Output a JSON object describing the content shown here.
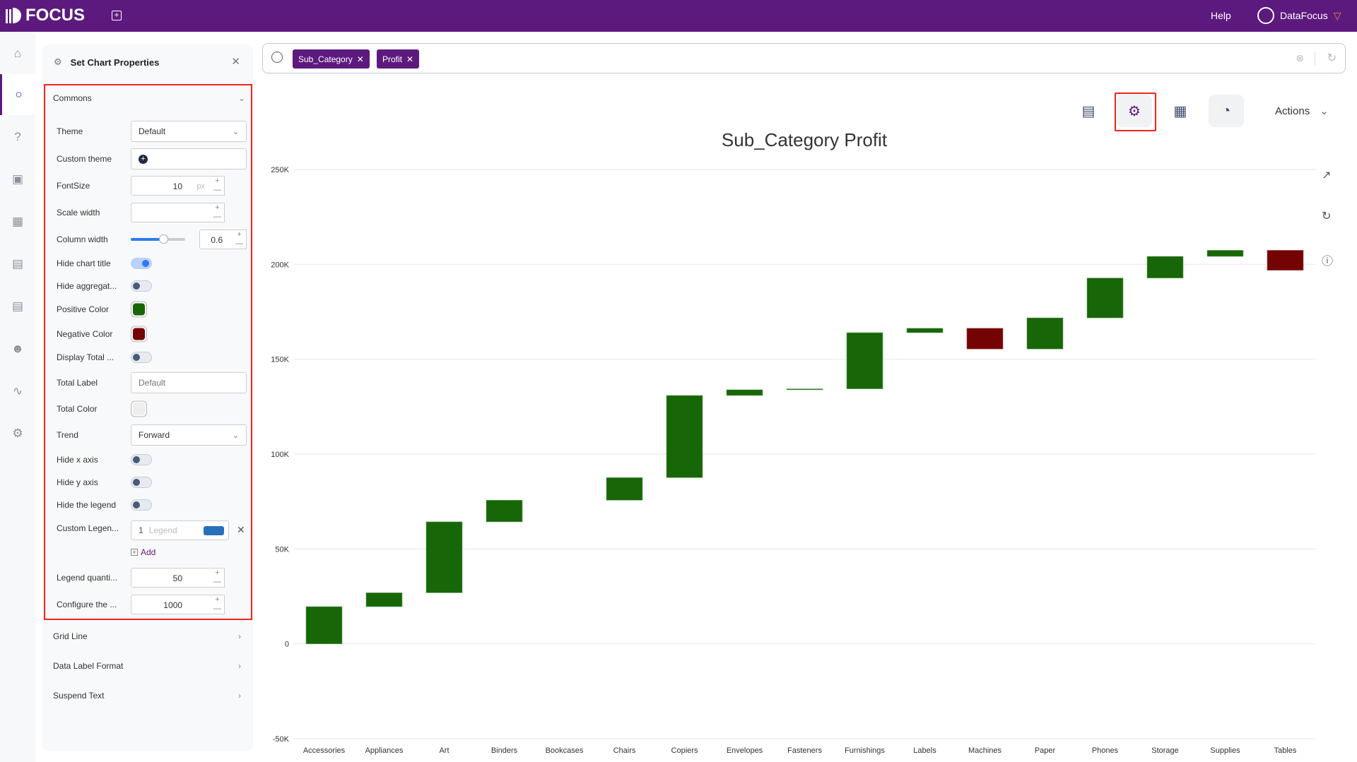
{
  "header": {
    "logo_text": "FOCUS",
    "help": "Help",
    "user": "DataFocus"
  },
  "sidebar": {
    "items": [
      "home-icon",
      "search-icon",
      "question-icon",
      "presentation-icon",
      "table-icon",
      "folder-icon",
      "clipboard-icon",
      "user-icon",
      "pulse-icon",
      "settings-icon"
    ],
    "active": "search-icon"
  },
  "panel": {
    "title": "Set Chart Properties",
    "commons": {
      "section": "Commons",
      "theme_label": "Theme",
      "theme_value": "Default",
      "custom_theme_label": "Custom theme",
      "fontsize_label": "FontSize",
      "fontsize_value": "10",
      "fontsize_unit": "px",
      "scale_width_label": "Scale width",
      "scale_width_value": "",
      "column_width_label": "Column width",
      "column_width_value": "0.6",
      "hide_chart_title_label": "Hide chart title",
      "hide_chart_title": true,
      "hide_aggregate_label": "Hide aggregat...",
      "hide_aggregate": false,
      "positive_color_label": "Positive Color",
      "positive_color": "#176607",
      "negative_color_label": "Negative Color",
      "negative_color": "#740404",
      "display_total_label": "Display Total ...",
      "display_total": false,
      "total_label_label": "Total Label",
      "total_label_placeholder": "Default",
      "total_color_label": "Total Color",
      "total_color": "#eeeeee",
      "trend_label": "Trend",
      "trend_value": "Forward",
      "hide_x_axis_label": "Hide x axis",
      "hide_x_axis": false,
      "hide_y_axis_label": "Hide y axis",
      "hide_y_axis": false,
      "hide_legend_label": "Hide the legend",
      "hide_legend": false,
      "custom_legend_label": "Custom Legen...",
      "custom_legend_index": "1",
      "custom_legend_placeholder": "Legend",
      "custom_legend_color": "#2a6fba",
      "add_label": "Add",
      "legend_quantity_label": "Legend quanti...",
      "legend_quantity_value": "50",
      "configure_label": "Configure the ...",
      "configure_value": "1000"
    },
    "sections": [
      "Grid Line",
      "Data Label Format",
      "Suspend Text"
    ]
  },
  "search": {
    "tags": [
      "Sub_Category",
      "Profit"
    ]
  },
  "toolbar": {
    "actions": "Actions"
  },
  "chart_data": {
    "type": "waterfall",
    "title": "Sub_Category Profit",
    "categories": [
      "Accessories",
      "Appliances",
      "Art",
      "Binders",
      "Bookcases",
      "Chairs",
      "Copiers",
      "Envelopes",
      "Fasteners",
      "Furnishings",
      "Labels",
      "Machines",
      "Paper",
      "Phones",
      "Storage",
      "Supplies",
      "Tables"
    ],
    "values": [
      19600,
      7300,
      37400,
      11400,
      0,
      11900,
      43300,
      3000,
      500,
      29600,
      2300,
      -10900,
      16400,
      21000,
      11400,
      3200,
      -10500
    ],
    "ylim": [
      -50000,
      250000
    ],
    "yticks": [
      "-50K",
      "0",
      "50K",
      "100K",
      "150K",
      "200K",
      "250K"
    ],
    "ytick_values": [
      -50000,
      0,
      50000,
      100000,
      150000,
      200000,
      250000
    ],
    "positive_color": "#176607",
    "negative_color": "#740404",
    "grid": true
  }
}
